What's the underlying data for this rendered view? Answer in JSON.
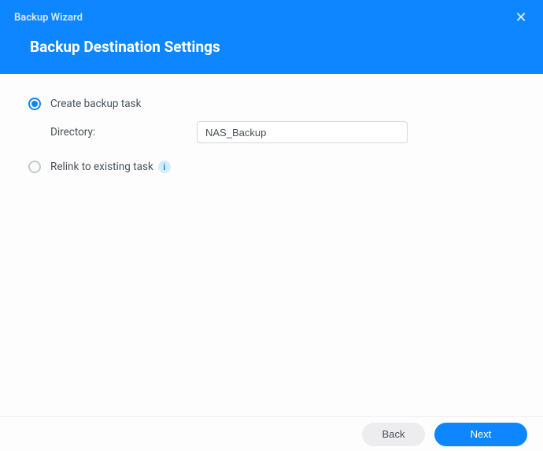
{
  "window": {
    "title": "Backup Wizard"
  },
  "page": {
    "title": "Backup Destination Settings"
  },
  "options": {
    "create": {
      "label": "Create backup task",
      "selected": true
    },
    "relink": {
      "label": "Relink to existing task",
      "selected": false
    }
  },
  "fields": {
    "directory": {
      "label": "Directory:",
      "value": "NAS_Backup"
    }
  },
  "icons": {
    "info": "i",
    "close": "✕"
  },
  "footer": {
    "back": "Back",
    "next": "Next"
  }
}
